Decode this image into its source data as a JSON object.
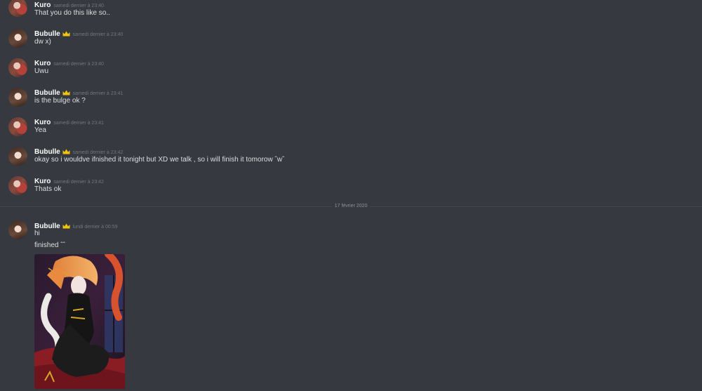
{
  "messages": [
    {
      "user": "Kuro",
      "crown": false,
      "timestamp": "samedi dernier à 23:40",
      "lines": [
        "That you do this like so.."
      ]
    },
    {
      "user": "Bubulle",
      "crown": true,
      "timestamp": "samedi dernier à 23:40",
      "lines": [
        "dw x)"
      ]
    },
    {
      "user": "Kuro",
      "crown": false,
      "timestamp": "samedi dernier à 23:40",
      "lines": [
        "Uwu"
      ]
    },
    {
      "user": "Bubulle",
      "crown": true,
      "timestamp": "samedi dernier à 23:41",
      "lines": [
        "is the bulge ok ?"
      ]
    },
    {
      "user": "Kuro",
      "crown": false,
      "timestamp": "samedi dernier à 23:41",
      "lines": [
        "Yea"
      ]
    },
    {
      "user": "Bubulle",
      "crown": true,
      "timestamp": "samedi dernier à 23:42",
      "lines": [
        "okay so i wouldve ifnished it tonight but XD we talk , so i will finish it tomorow ˆwˆ"
      ]
    },
    {
      "user": "Kuro",
      "crown": false,
      "timestamp": "samedi dernier à 23:42",
      "lines": [
        "Thats ok"
      ]
    },
    {
      "user": "Bubulle",
      "crown": true,
      "timestamp": "lundi dernier à 00:59",
      "lines": [
        "hi",
        "finished ˆˆ"
      ],
      "has_image": true
    }
  ],
  "date_divider": "17 février 2020",
  "colors": {
    "background": "#36393f",
    "username": "#ffffff",
    "message_text": "#dcddde",
    "timestamp": "#72767d",
    "crown": "#f1c40f"
  },
  "icons": {
    "crown": "crown-icon"
  }
}
